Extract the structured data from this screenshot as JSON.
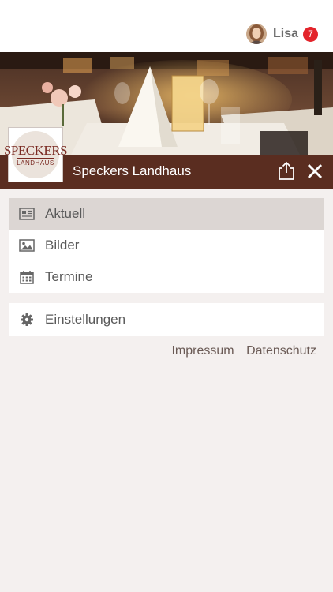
{
  "user": {
    "name": "Lisa",
    "notification_count": "7"
  },
  "header": {
    "title": "Speckers Landhaus"
  },
  "logo": {
    "line1": "SPECKERS",
    "line2": "LANDHAUS"
  },
  "menu": {
    "items": [
      {
        "label": "Aktuell",
        "icon": "newspaper-icon",
        "active": true
      },
      {
        "label": "Bilder",
        "icon": "image-icon",
        "active": false
      },
      {
        "label": "Termine",
        "icon": "calendar-icon",
        "active": false
      }
    ],
    "settings": {
      "label": "Einstellungen",
      "icon": "gear-icon"
    }
  },
  "footer_links": {
    "impressum": "Impressum",
    "datenschutz": "Datenschutz"
  },
  "colors": {
    "header": "#5a2d20",
    "badge": "#e3242b",
    "background": "#f4f0ef",
    "active_item": "#dcd6d3"
  }
}
